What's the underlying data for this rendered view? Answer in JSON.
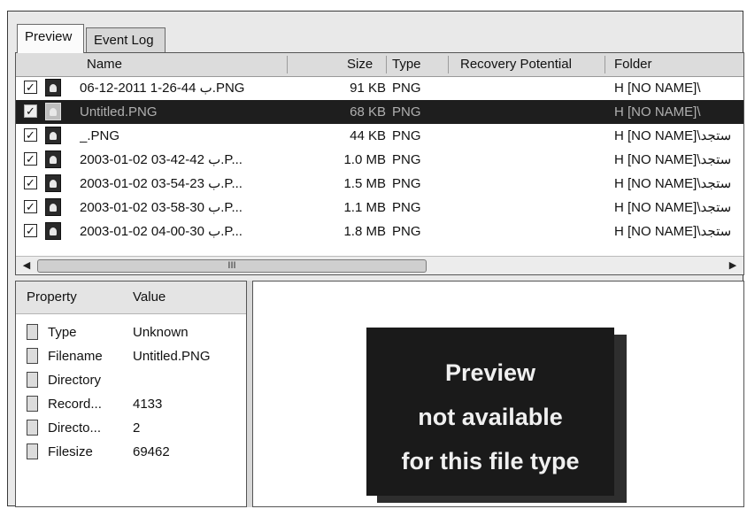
{
  "tabs": [
    {
      "label": "Preview",
      "active": true
    },
    {
      "label": "Event Log",
      "active": false
    }
  ],
  "file_list": {
    "columns": [
      "Name",
      "Size",
      "Type",
      "Recovery Potential",
      "Folder"
    ],
    "rows": [
      {
        "checked": true,
        "name": "06-12-2011 1-26-44 ب.PNG",
        "size": "91 KB",
        "type": "PNG",
        "folder": "H [NO NAME]\\",
        "selected": false
      },
      {
        "checked": true,
        "name": "Untitled.PNG",
        "size": "68 KB",
        "type": "PNG",
        "folder": "H [NO NAME]\\",
        "selected": true
      },
      {
        "checked": true,
        "name": "_.PNG",
        "size": "44 KB",
        "type": "PNG",
        "folder": "H [NO NAME]\\ستجد",
        "selected": false
      },
      {
        "checked": true,
        "name": "2003-01-02 03-42-42 ب.P...",
        "size": "1.0 MB",
        "type": "PNG",
        "folder": "H [NO NAME]\\ستجد",
        "selected": false
      },
      {
        "checked": true,
        "name": "2003-01-02 03-54-23 ب.P...",
        "size": "1.5 MB",
        "type": "PNG",
        "folder": "H [NO NAME]\\ستجد",
        "selected": false
      },
      {
        "checked": true,
        "name": "2003-01-02 03-58-30 ب.P...",
        "size": "1.1 MB",
        "type": "PNG",
        "folder": "H [NO NAME]\\ستجد",
        "selected": false
      },
      {
        "checked": true,
        "name": "2003-01-02 04-00-30 ب.P...",
        "size": "1.8 MB",
        "type": "PNG",
        "folder": "H [NO NAME]\\ستجد",
        "selected": false
      }
    ],
    "scrollbar_thumb_grip": "III"
  },
  "properties": {
    "columns": [
      "Property",
      "Value"
    ],
    "rows": [
      {
        "property": "Type",
        "value": "Unknown"
      },
      {
        "property": "Filename",
        "value": "Untitled.PNG"
      },
      {
        "property": "Directory",
        "value": ""
      },
      {
        "property": "Record...",
        "value": "4133"
      },
      {
        "property": "Directo...",
        "value": "2"
      },
      {
        "property": "Filesize",
        "value": "69462"
      }
    ]
  },
  "preview": {
    "lines": [
      "Preview",
      "not available",
      "for this file type"
    ]
  }
}
